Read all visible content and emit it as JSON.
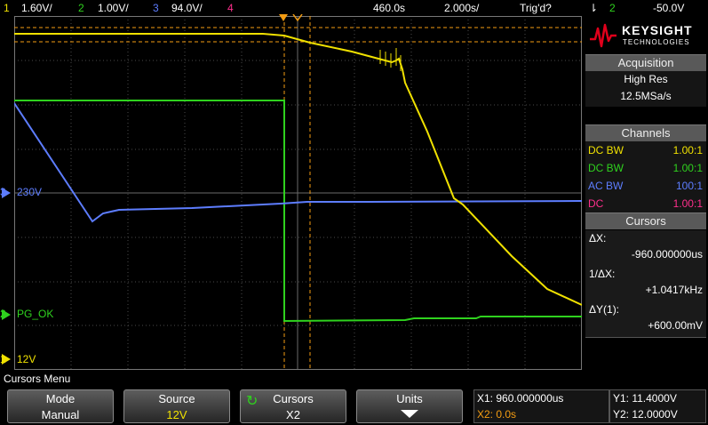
{
  "top_bar": {
    "ch1_num": "1",
    "ch1_scale": "1.60V/",
    "ch2_num": "2",
    "ch2_scale": "1.00V/",
    "ch3_num": "3",
    "ch3_scale": "94.0V/",
    "ch4_num": "4",
    "time_delay": "460.0s",
    "time_scale": "2.000s/",
    "trigger_status": "Trig'd?",
    "trigger_slope_icon": "falling-edge-icon",
    "trigger_source": "2",
    "trigger_level": "-50.0V"
  },
  "brand": {
    "name": "KEYSIGHT",
    "sub": "TECHNOLOGIES"
  },
  "acquisition": {
    "title": "Acquisition",
    "mode": "High Res",
    "rate": "12.5MSa/s"
  },
  "channels": {
    "title": "Channels",
    "rows": [
      {
        "coupling": "DC BW",
        "probe": "1.00:1",
        "color": "#f0e100"
      },
      {
        "coupling": "DC BW",
        "probe": "1.00:1",
        "color": "#2fd21e"
      },
      {
        "coupling": "AC BW",
        "probe": "100:1",
        "color": "#5d7dff"
      },
      {
        "coupling": "DC",
        "probe": "1.00:1",
        "color": "#ff2f8c"
      }
    ]
  },
  "cursors_panel": {
    "title": "Cursors",
    "dx_label": "ΔX:",
    "dx_value": "-960.000000us",
    "inv_dx_label": "1/ΔX:",
    "inv_dx_value": "+1.0417kHz",
    "dy_label": "ΔY(1):",
    "dy_value": "+600.00mV"
  },
  "waveform_labels": {
    "ch3_marker": "3",
    "ch3_label": "230V",
    "ch2_marker": "2",
    "ch2_label": "PG_OK",
    "ch1_marker": "1",
    "ch1_label": "12V"
  },
  "menu": {
    "title": "Cursors Menu",
    "softkeys": [
      {
        "top": "Mode",
        "bottom": "Manual"
      },
      {
        "top": "Source",
        "bottom": "12V"
      },
      {
        "top": "Cursors",
        "bottom": "X2",
        "icon": "rotate-knob-icon"
      },
      {
        "top": "Units",
        "bottom": "",
        "icon": "arrow-down-icon"
      }
    ]
  },
  "readouts": {
    "x1": "X1: 960.000000us",
    "x2": "X2: 0.0s",
    "y1": "Y1: 11.4000V",
    "y2": "Y2: 12.0000V"
  },
  "colors": {
    "ch1": "#f0e100",
    "ch2": "#2fd21e",
    "ch3": "#5d7dff",
    "ch4": "#ff2f8c",
    "cursor": "#f39c12",
    "accent_red": "#e0001b"
  }
}
